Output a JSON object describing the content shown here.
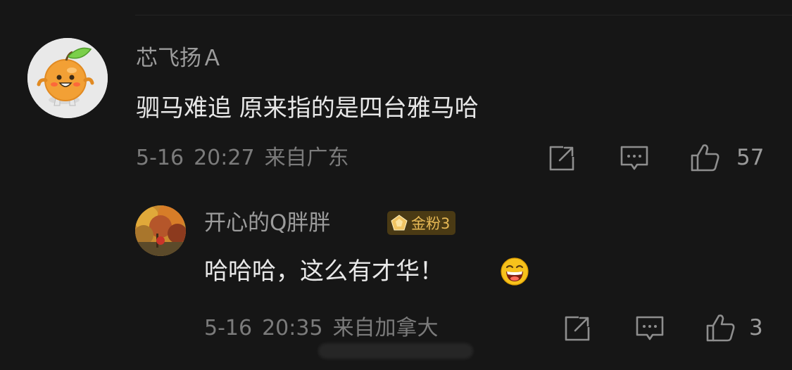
{
  "comment": {
    "username": "芯飞扬Ａ",
    "text": "驷马难追 原来指的是四台雅马哈",
    "date": "5-16",
    "time": "20:27",
    "location": "来自广东",
    "likes": "57",
    "avatar_icon": "orange-mascot-icon"
  },
  "reply": {
    "username": "开心的Q胖胖",
    "badge": "金粉3",
    "badge_color": "#e7b955",
    "text": "哈哈哈，这么有才华！",
    "emoji": "laughing-emoji-icon",
    "date": "5-16",
    "time": "20:35",
    "location": "来自加拿大",
    "likes": "3",
    "avatar_icon": "autumn-trees-avatar"
  },
  "icons": {
    "share": "share-icon",
    "comment": "comment-icon",
    "like": "thumbs-up-icon"
  },
  "colors": {
    "background": "#161616",
    "username": "#9c9c9c",
    "text": "#e8e8e8",
    "meta": "#7b7b7b"
  }
}
